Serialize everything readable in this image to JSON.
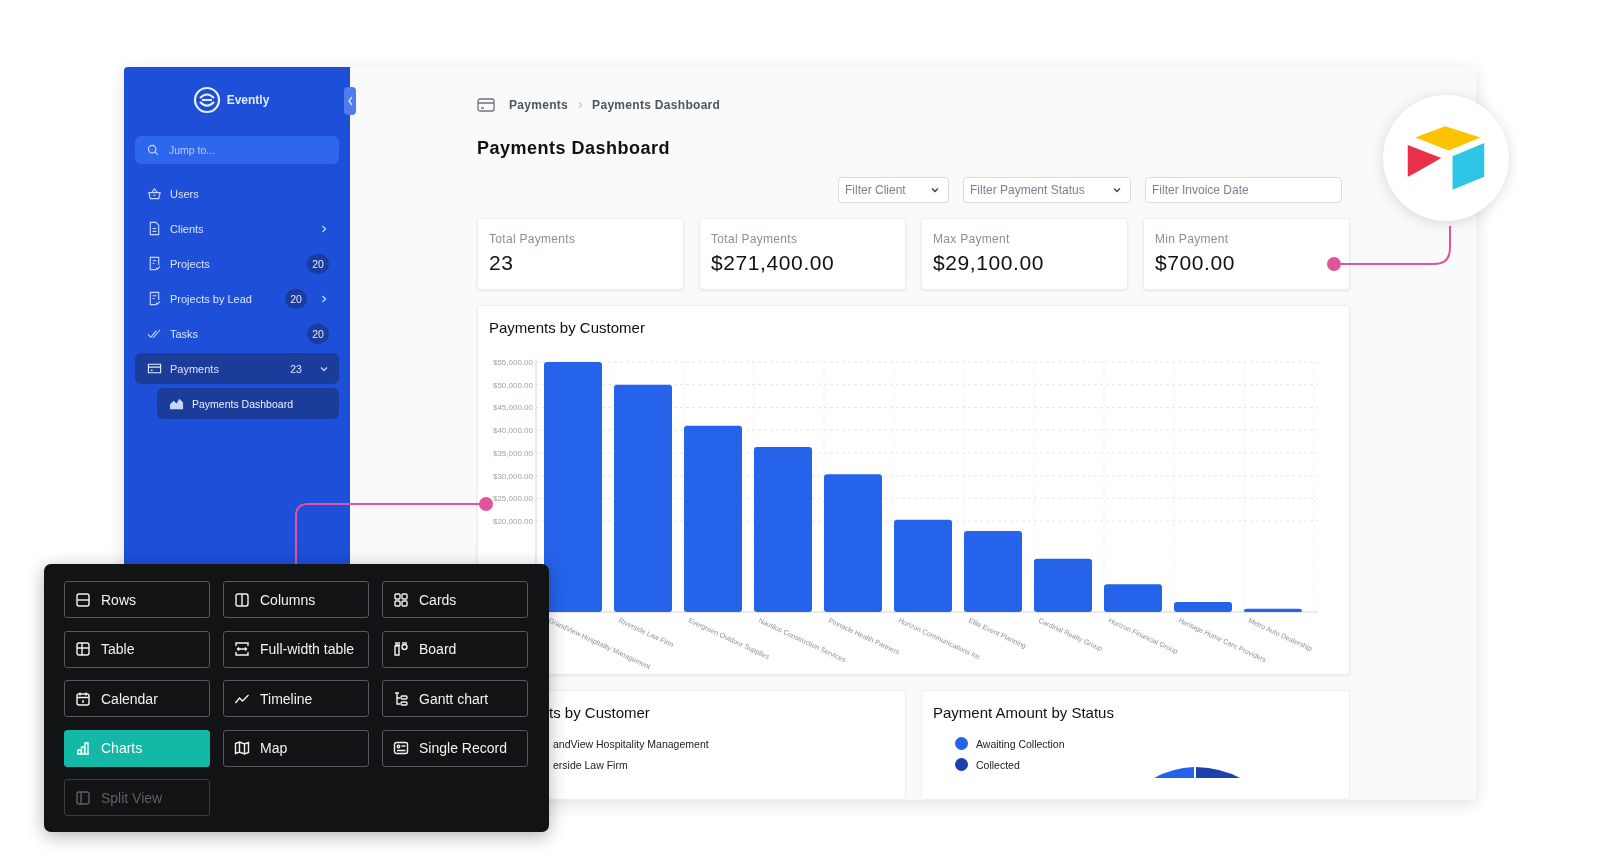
{
  "sidebar": {
    "brand": "Evently",
    "search": {
      "placeholder": "Jump to..."
    },
    "items": [
      {
        "label": "Users",
        "selected": false
      },
      {
        "label": "Clients",
        "selected": false,
        "expanded": false
      },
      {
        "label": "Projects",
        "badge": "20",
        "selected": false
      },
      {
        "label": "Projects by Lead",
        "badge": "20",
        "selected": false,
        "expanded": false
      },
      {
        "label": "Tasks",
        "badge": "20",
        "selected": false
      },
      {
        "label": "Payments",
        "badge": "23",
        "selected": true,
        "expanded": true,
        "children": [
          {
            "label": "Payments Dashboard",
            "selected": true
          }
        ]
      }
    ]
  },
  "breadcrumb": [
    "Payments",
    "Payments Dashboard"
  ],
  "title": "Payments Dashboard",
  "filters": [
    {
      "kind": "select",
      "placeholder": "Filter Client"
    },
    {
      "kind": "select",
      "placeholder": "Filter Payment Status"
    },
    {
      "kind": "date",
      "placeholder": "Filter Invoice Date"
    }
  ],
  "stats": [
    {
      "label": "Total Payments",
      "value": "23"
    },
    {
      "label": "Total Payments",
      "value": "$271,400.00"
    },
    {
      "label": "Max Payment",
      "value": "$29,100.00"
    },
    {
      "label": "Min Payment",
      "value": "$700.00"
    }
  ],
  "main_chart": {
    "chart_data": {
      "type": "bar",
      "title": "Payments by Customer",
      "grid": true,
      "categories": [
        "GrandView Hospitality Management",
        "Riverside Law Firm",
        "Evergreen Outdoor Supplies",
        "Nautilus Construction Services",
        "Pinnacle Health Partners",
        "Horizon Communications Inc",
        "Elite Event Planning",
        "Cardinal Realty Group",
        "Horizon Financial Group",
        "Heritage Home Care Providers",
        "Metro Auto Dealership"
      ],
      "values": [
        55000,
        50000,
        41000,
        36300,
        30300,
        20300,
        17800,
        11700,
        6100,
        2200,
        700
      ],
      "ylim": [
        0,
        55000
      ],
      "yticks": [
        {
          "value": 20000,
          "label": "$20,000.00"
        },
        {
          "value": 25000,
          "label": "$25,000.00"
        },
        {
          "value": 30000,
          "label": "$30,000.00"
        },
        {
          "value": 35000,
          "label": "$35,000.00"
        },
        {
          "value": 40000,
          "label": "$40,000.00"
        },
        {
          "value": 45000,
          "label": "$45,000.00"
        },
        {
          "value": 50000,
          "label": "$50,000.00"
        },
        {
          "value": 55000,
          "label": "$55,000.00"
        }
      ]
    }
  },
  "bottom_cards": [
    {
      "title": "ts by Customer",
      "legend": [
        {
          "label": "andView Hospitality Management"
        },
        {
          "label": "erside Law Firm"
        }
      ]
    },
    {
      "title": "Payment Amount by Status",
      "legend": [
        {
          "label": "Awaiting Collection",
          "color": "#2563eb"
        },
        {
          "label": "Collected",
          "color": "#1e40af"
        }
      ]
    }
  ],
  "view_picker": [
    {
      "label": "Rows",
      "selected": false,
      "disabled": false
    },
    {
      "label": "Columns",
      "selected": false,
      "disabled": false
    },
    {
      "label": "Cards",
      "selected": false,
      "disabled": false
    },
    {
      "label": "Table",
      "selected": false,
      "disabled": false
    },
    {
      "label": "Full-width table",
      "selected": false,
      "disabled": false
    },
    {
      "label": "Board",
      "selected": false,
      "disabled": false
    },
    {
      "label": "Calendar",
      "selected": false,
      "disabled": false
    },
    {
      "label": "Timeline",
      "selected": false,
      "disabled": false
    },
    {
      "label": "Gantt chart",
      "selected": false,
      "disabled": false
    },
    {
      "label": "Charts",
      "selected": true,
      "disabled": false
    },
    {
      "label": "Map",
      "selected": false,
      "disabled": false
    },
    {
      "label": "Single Record",
      "selected": false,
      "disabled": false
    },
    {
      "label": "Split View",
      "selected": false,
      "disabled": true
    }
  ]
}
